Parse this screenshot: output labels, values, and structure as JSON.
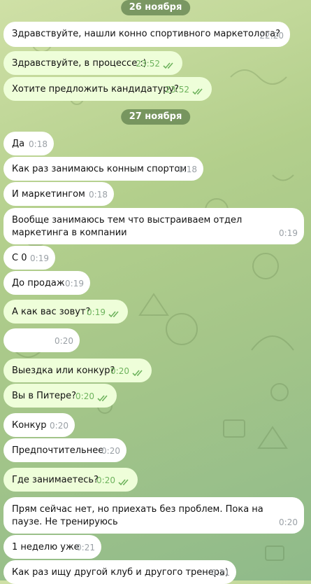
{
  "dates": [
    "26 ноября",
    "27 ноября"
  ],
  "messages": [
    {
      "text": "Здравствуйте, нашли конно спортивного маркетолога?",
      "time": "22:20",
      "out": false
    },
    {
      "text": "Здравствуйте, в процессе :)",
      "time": "23:52",
      "out": true
    },
    {
      "text": "Хотите предложить кандидатуру?",
      "time": "23:52",
      "out": true
    },
    {
      "text": "Да",
      "time": "0:18",
      "out": false
    },
    {
      "text": "Как раз занимаюсь конным спортом",
      "time": "0:18",
      "out": false
    },
    {
      "text": "И маркетингом",
      "time": "0:18",
      "out": false
    },
    {
      "text": "Вообще занимаюсь тем что выстраиваем отдел маркетинга в компании",
      "time": "0:19",
      "out": false
    },
    {
      "text": "С 0",
      "time": "0:19",
      "out": false
    },
    {
      "text": "До продаж",
      "time": "0:19",
      "out": false
    },
    {
      "text": "А как вас зовут?",
      "time": "0:19",
      "out": true
    },
    {
      "text": "",
      "time": "0:20",
      "out": false
    },
    {
      "text": "Выездка или конкур?",
      "time": "0:20",
      "out": true
    },
    {
      "text": "Вы в Питере?",
      "time": "0:20",
      "out": true
    },
    {
      "text": "Конкур",
      "time": "0:20",
      "out": false
    },
    {
      "text": "Предпочтительнее",
      "time": "0:20",
      "out": false
    },
    {
      "text": "Где занимаетесь?",
      "time": "0:20",
      "out": true
    },
    {
      "text": "Прям сейчас нет, но приехать без проблем. Пока на паузе. Не тренируюсь",
      "time": "0:20",
      "out": false
    },
    {
      "text": "1 неделю уже",
      "time": "0:21",
      "out": false
    },
    {
      "text": "Как раз ищу другой клуб и другого тренера)",
      "time": "0:21",
      "out": false
    }
  ],
  "colors": {
    "incoming_bubble": "#ffffff",
    "outgoing_bubble": "#eefed9",
    "read_check": "#6eb35d",
    "date_pill": "#60804e"
  },
  "icons": {
    "read_receipt": "double-check-icon"
  }
}
